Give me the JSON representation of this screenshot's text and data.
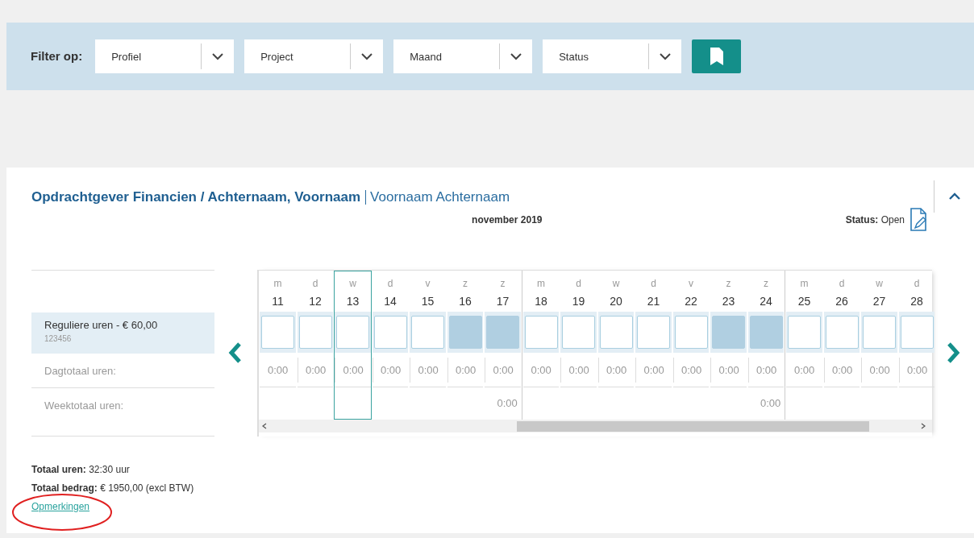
{
  "filter": {
    "label": "Filter op:",
    "selects": [
      {
        "placeholder": "Profiel"
      },
      {
        "placeholder": "Project"
      },
      {
        "placeholder": "Maand"
      },
      {
        "placeholder": "Status"
      }
    ]
  },
  "card": {
    "title": "Opdrachtgever Financien / Achternaam, Voornaam",
    "subtitle": "Voornaam Achternaam",
    "month": "november 2019",
    "status_label": "Status:",
    "status_value": "Open",
    "expanded": true
  },
  "rows": {
    "entry_label": "Reguliere uren - € 60,00",
    "entry_code": "123456",
    "day_total_label": "Dagtotaal uren:",
    "week_total_label": "Weektotaal uren:"
  },
  "weeks": [
    {
      "total": "0:00",
      "days": [
        {
          "letter": "m",
          "number": "11",
          "weekend": false,
          "selected": false,
          "total": "0:00"
        },
        {
          "letter": "d",
          "number": "12",
          "weekend": false,
          "selected": false,
          "total": "0:00"
        },
        {
          "letter": "w",
          "number": "13",
          "weekend": false,
          "selected": true,
          "total": "0:00"
        },
        {
          "letter": "d",
          "number": "14",
          "weekend": false,
          "selected": false,
          "total": "0:00"
        },
        {
          "letter": "v",
          "number": "15",
          "weekend": false,
          "selected": false,
          "total": "0:00"
        },
        {
          "letter": "z",
          "number": "16",
          "weekend": true,
          "selected": false,
          "total": "0:00"
        },
        {
          "letter": "z",
          "number": "17",
          "weekend": true,
          "selected": false,
          "total": "0:00"
        }
      ]
    },
    {
      "total": "0:00",
      "days": [
        {
          "letter": "m",
          "number": "18",
          "weekend": false,
          "selected": false,
          "total": "0:00"
        },
        {
          "letter": "d",
          "number": "19",
          "weekend": false,
          "selected": false,
          "total": "0:00"
        },
        {
          "letter": "w",
          "number": "20",
          "weekend": false,
          "selected": false,
          "total": "0:00"
        },
        {
          "letter": "d",
          "number": "21",
          "weekend": false,
          "selected": false,
          "total": "0:00"
        },
        {
          "letter": "v",
          "number": "22",
          "weekend": false,
          "selected": false,
          "total": "0:00"
        },
        {
          "letter": "z",
          "number": "23",
          "weekend": true,
          "selected": false,
          "total": "0:00"
        },
        {
          "letter": "z",
          "number": "24",
          "weekend": true,
          "selected": false,
          "total": "0:00"
        }
      ]
    },
    {
      "days": [
        {
          "letter": "m",
          "number": "25",
          "weekend": false,
          "selected": false,
          "total": "0:00"
        },
        {
          "letter": "d",
          "number": "26",
          "weekend": false,
          "selected": false,
          "total": "0:00"
        },
        {
          "letter": "w",
          "number": "27",
          "weekend": false,
          "selected": false,
          "total": "0:00"
        },
        {
          "letter": "d",
          "number": "28",
          "weekend": false,
          "selected": false,
          "total": "0:00"
        }
      ]
    }
  ],
  "totals": {
    "hours_label": "Totaal uren:",
    "hours_value": "32:30 uur",
    "amount_label": "Totaal bedrag:",
    "amount_value": "€ 1950,00 (excl BTW)",
    "remarks_link": "Opmerkingen"
  }
}
